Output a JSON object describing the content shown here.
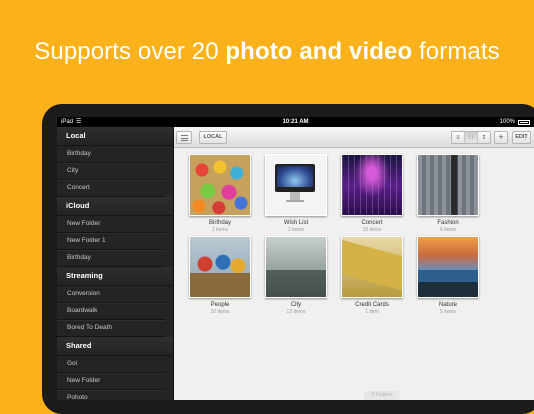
{
  "headline": {
    "part1": "Supports over 20 ",
    "bold": "photo and video",
    "part2": " formats"
  },
  "statusbar": {
    "carrier": "iPad",
    "time": "10:21 AM",
    "battery": "100%"
  },
  "sidebar": {
    "sections": [
      {
        "title": "Local",
        "items": [
          "Birthday",
          "City",
          "Concert"
        ]
      },
      {
        "title": "iCloud",
        "items": [
          "New Folder",
          "New Folder 1",
          "Birthday"
        ]
      },
      {
        "title": "Streaming",
        "items": [
          "Conversion",
          "Boardwalk",
          "Bored To Death"
        ]
      },
      {
        "title": "Shared",
        "items": [
          "Goi",
          "New Folder",
          "Pohoto"
        ]
      }
    ]
  },
  "toolbar": {
    "local_label": "LOCAL",
    "plus_label": "+",
    "edit_label": "EDIT"
  },
  "albums": [
    {
      "name": "Birthday",
      "count": "2 items",
      "icon": "balloons-photo"
    },
    {
      "name": "Wish List",
      "count": "2 items",
      "icon": "imac-photo"
    },
    {
      "name": "Concert",
      "count": "10 items",
      "icon": "concert-photo"
    },
    {
      "name": "Fashion",
      "count": "6 items",
      "icon": "fashion-photo"
    },
    {
      "name": "People",
      "count": "10 items",
      "icon": "people-photo"
    },
    {
      "name": "City",
      "count": "12 items",
      "icon": "city-photo"
    },
    {
      "name": "Credit Cards",
      "count": "1 item",
      "icon": "credit-cards-photo"
    },
    {
      "name": "Nature",
      "count": "5 items",
      "icon": "nature-photo"
    }
  ],
  "footer": {
    "label": "8 Folders"
  },
  "colors": {
    "background": "#fbb21a",
    "sidebar": "#232425",
    "content": "#f0f0f0"
  }
}
